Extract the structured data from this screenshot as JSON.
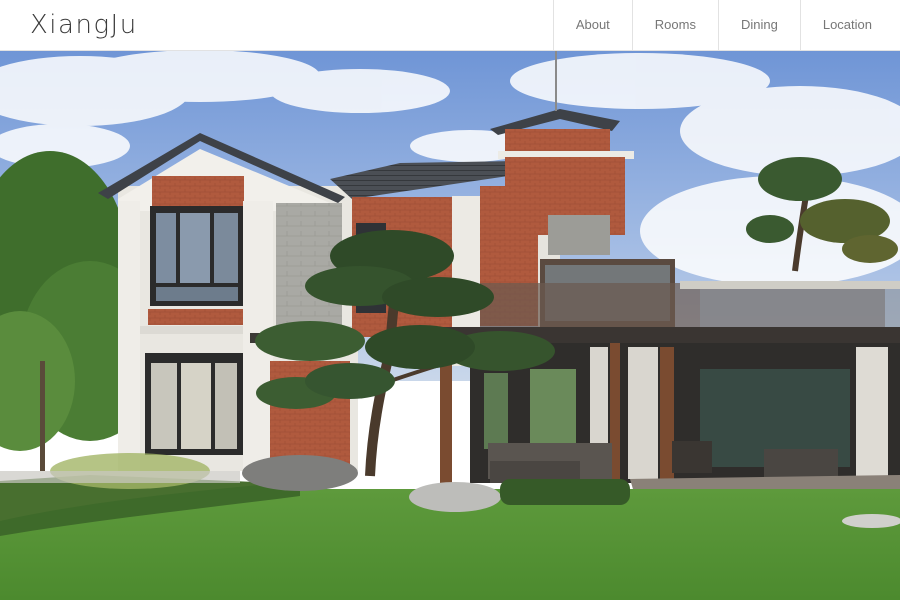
{
  "site": {
    "logo_text": "XiangJu"
  },
  "nav": {
    "items": [
      {
        "label": "About",
        "icon": null
      },
      {
        "label": "Rooms",
        "icon": null
      },
      {
        "label": "Dining",
        "icon": null
      },
      {
        "label": "Location",
        "icon": null
      }
    ]
  },
  "hero": {
    "subject": "house-with-garden-photo"
  },
  "colors": {
    "header_bg": "#ffffff",
    "nav_text": "#777777",
    "logo_text": "#3a3a3a",
    "divider": "#e2e2e2"
  }
}
